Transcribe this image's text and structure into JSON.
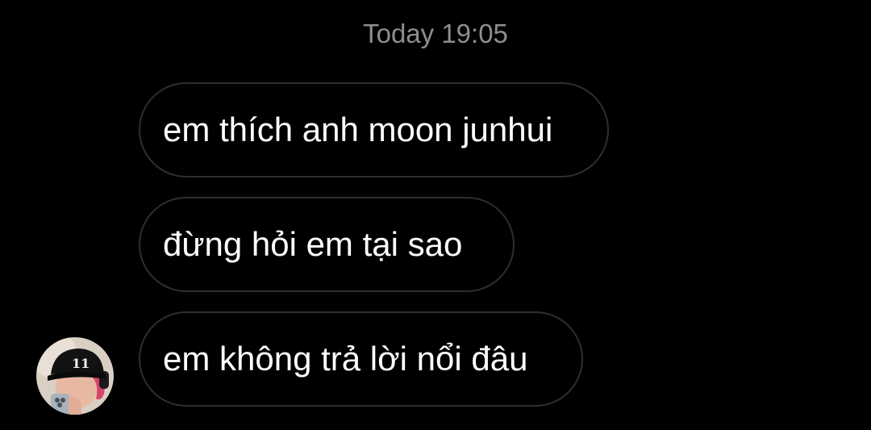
{
  "thread": {
    "timestamp": "Today 19:05"
  },
  "messages": [
    {
      "text": "em thích anh moon junhui"
    },
    {
      "text": "đừng hỏi em tại sao"
    },
    {
      "text": "em không trả lời nổi đâu"
    }
  ],
  "sender": {
    "avatar_icon": "profile-photo",
    "cap_text": "11"
  },
  "colors": {
    "background": "#000000",
    "bubble_border": "#2e2e2e",
    "timestamp": "#8e8e8e",
    "message_text": "#ffffff"
  }
}
